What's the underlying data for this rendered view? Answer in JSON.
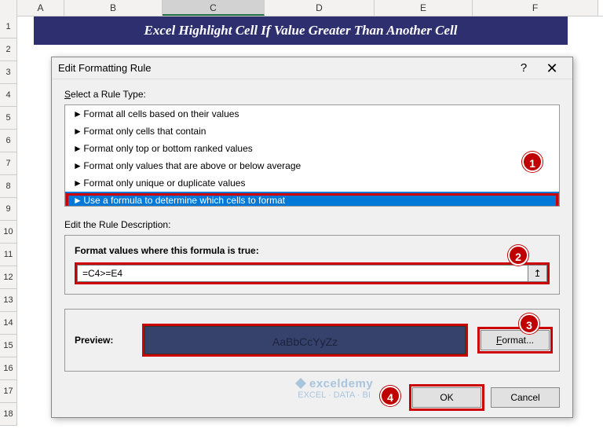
{
  "columns": [
    "A",
    "B",
    "C",
    "D",
    "E",
    "F"
  ],
  "rows": [
    "1",
    "2",
    "3",
    "4",
    "5",
    "6",
    "7",
    "8",
    "9",
    "10",
    "11",
    "12",
    "13",
    "14",
    "15",
    "16",
    "17",
    "18"
  ],
  "title_band": "Excel Highlight Cell If Value Greater Than Another Cell",
  "dialog": {
    "title": "Edit Formatting Rule",
    "help": "?",
    "close": "✕",
    "select_label_pre": "S",
    "select_label_text": "elect a Rule Type:",
    "rule_types": [
      "Format all cells based on their values",
      "Format only cells that contain",
      "Format only top or bottom ranked values",
      "Format only values that are above or below average",
      "Format only unique or duplicate values",
      "Use a formula to determine which cells to format"
    ],
    "edit_label": "Edit the Rule Description:",
    "formula_label": "Format values where this formula is true:",
    "formula_value": "=C4>=E4",
    "ref_btn": "↥",
    "preview_label": "Preview:",
    "preview_text": "AaBbCcYyZz",
    "format_btn": "Format...",
    "ok": "OK",
    "cancel": "Cancel"
  },
  "badges": {
    "b1": "1",
    "b2": "2",
    "b3": "3",
    "b4": "4"
  },
  "watermark": {
    "name": "exceldemy",
    "tag": "EXCEL · DATA · BI"
  }
}
